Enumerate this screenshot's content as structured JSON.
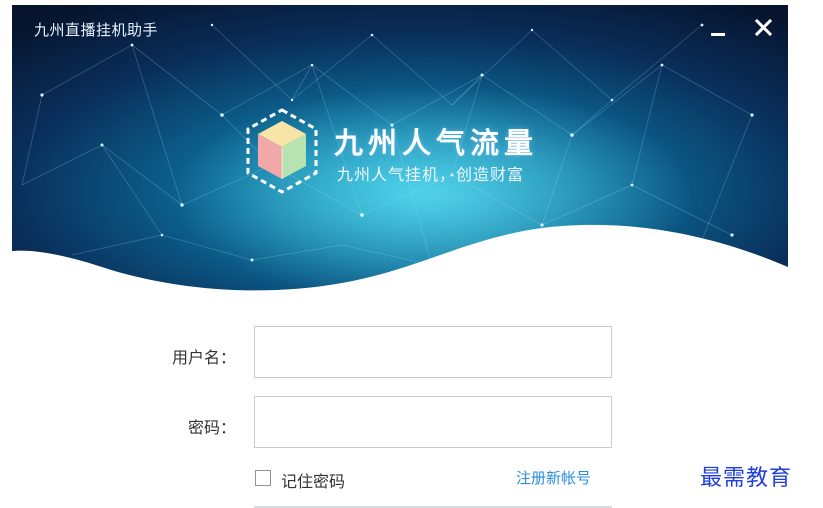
{
  "window": {
    "title": "九州直播挂机助手"
  },
  "brand": {
    "name": "九州人气流量",
    "slogan": "九州人气挂机，创造财富"
  },
  "form": {
    "username_label": "用户名：",
    "username_value": "",
    "password_label": "密码：",
    "password_value": "",
    "remember_label": "记住密码",
    "remember_checked": false,
    "register_link": "注册新帐号"
  },
  "watermark": "最需教育",
  "icons": {
    "minimize": "minimize-icon",
    "close": "close-icon",
    "logo": "cube-logo-icon",
    "checkbox": "checkbox-icon"
  },
  "colors": {
    "banner_dark": "#06142e",
    "banner_mid": "#0d5c86",
    "banner_glow": "#18a3c9",
    "link": "#2c8ee0",
    "watermark": "#1f3fd8"
  }
}
